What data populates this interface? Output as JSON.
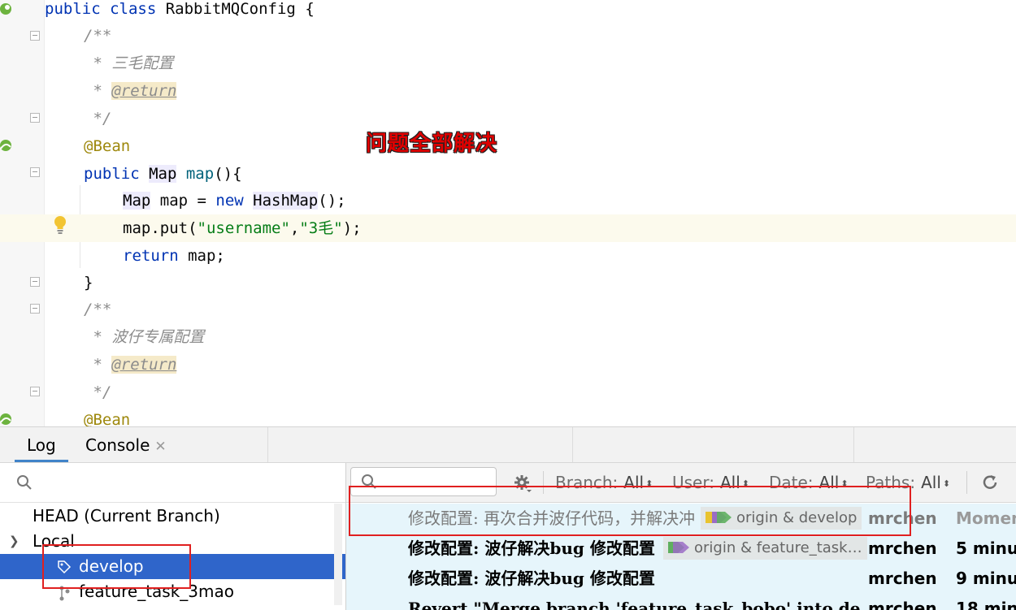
{
  "editor": {
    "line1": {
      "kw": "public class ",
      "name": "RabbitMQConfig",
      "brace": " {"
    },
    "javadoc_open": "/**",
    "javadoc_sanmao": " * 三毛配置",
    "javadoc_star": " * ",
    "javadoc_return": "@return",
    "javadoc_close": " */",
    "annotation": "@Bean",
    "method_sig": {
      "kw": "public ",
      "type": "Map",
      "space": " ",
      "name": "map",
      "rest": "(){"
    },
    "stmt1": {
      "type": "Map",
      "mid": " map = ",
      "kw": "new ",
      "type2": "HashMap",
      "rest": "();"
    },
    "stmt2": {
      "prefix": "map.put(",
      "str1": "\"username\"",
      "comma": ",",
      "str2": "\"3毛\"",
      "rest": ");"
    },
    "stmt3": {
      "kw": "return ",
      "rest": "map;"
    },
    "close_brace": "}",
    "javadoc_bozai": " * 波仔专属配置",
    "annotation2": "@Bean",
    "overlay_note": "问题全部解决"
  },
  "toolwindow": {
    "tabs": {
      "log": "Log",
      "console": "Console",
      "close": "✕"
    },
    "branches": {
      "head": "HEAD (Current Branch)",
      "local": "Local",
      "items": [
        "develop",
        "feature_task_3mao"
      ]
    },
    "filters": {
      "branch": {
        "label": "Branch:",
        "value": "All"
      },
      "user": {
        "label": "User:",
        "value": "All"
      },
      "date": {
        "label": "Date:",
        "value": "All"
      },
      "paths": {
        "label": "Paths:",
        "value": "All"
      }
    },
    "commits": [
      {
        "subject": "修改配置: 再次合并波仔代码，并解决冲",
        "ref": "origin & develop",
        "author": "mrchen",
        "date": "Momen"
      },
      {
        "subject": "修改配置: 波仔解决bug 修改配置",
        "ref": "origin & feature_task…",
        "author": "mrchen",
        "date": "5 minu"
      },
      {
        "subject": "修改配置: 波仔解决bug 修改配置",
        "ref": "",
        "author": "mrchen",
        "date": "9 minu"
      },
      {
        "subject": "Revert \"Merge branch 'feature_task_bobo' into de",
        "ref": "",
        "author": "mrchen",
        "date": "18 min"
      }
    ]
  },
  "colors": {
    "selection": "#2f65ca",
    "highlight_box": "#e02020",
    "graph": "#5b8a4b"
  }
}
